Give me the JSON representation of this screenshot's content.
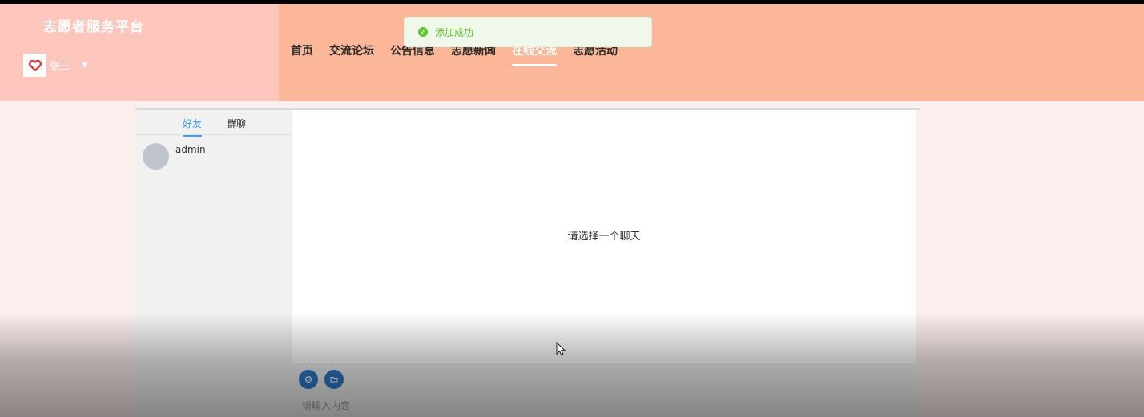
{
  "brand": {
    "title": "志愿者服务平台"
  },
  "user": {
    "name": "张三",
    "logo_icon": "heart-icon"
  },
  "nav": {
    "items": [
      "首页",
      "交流论坛",
      "公告信息",
      "志愿新闻",
      "在线交流",
      "志愿活动"
    ],
    "active_index": 4
  },
  "toast": {
    "message": "添加成功",
    "icon": "check-circle-icon"
  },
  "chat": {
    "tabs": [
      "好友",
      "群聊"
    ],
    "active_tab": 0,
    "friends": [
      {
        "name": "admin"
      }
    ],
    "empty_hint": "请选择一个聊天",
    "input_placeholder": "请输入内容",
    "tools": [
      "image-icon",
      "folder-icon"
    ]
  },
  "colors": {
    "header": "#fbb797",
    "brand_area": "#fcc6bc",
    "accent": "#409eff",
    "success": "#67c23a",
    "tool_button": "#2f79c6"
  }
}
